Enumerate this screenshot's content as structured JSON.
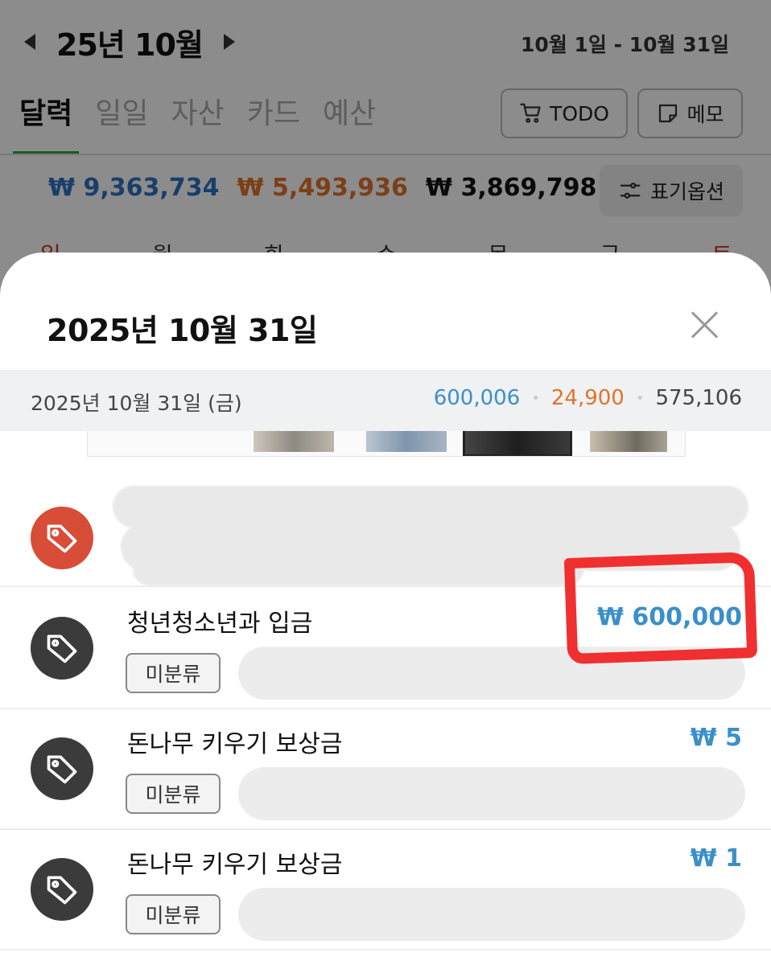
{
  "header": {
    "month_title": "25년 10월",
    "date_range": "10월 1일 - 10월 31일"
  },
  "tabs": [
    "달력",
    "일일",
    "자산",
    "카드",
    "예산"
  ],
  "actions": {
    "todo_label": "TODO",
    "memo_label": "메모",
    "display_options_label": "표기옵션"
  },
  "summary": {
    "income": "₩ 9,363,734",
    "expense": "₩ 5,493,936",
    "total": "₩ 3,869,798"
  },
  "weekdays": [
    "일",
    "월",
    "화",
    "수",
    "목",
    "금",
    "토"
  ],
  "colors": {
    "income": "#2f72c4",
    "expense": "#e0742b",
    "accent_green": "#2eaa3c",
    "annotation_red": "#f03030"
  },
  "sheet": {
    "title": "2025년 10월 31일",
    "day_label": "2025년 10월 31일 (금)",
    "day_income": "600,006",
    "day_expense": "24,900",
    "day_total": "575,106",
    "separator": "•",
    "transactions": [
      {
        "title": "청년청소년과 입금",
        "amount": "₩ 600,000",
        "category": "미분류",
        "icon": "tag-icon"
      },
      {
        "title": "돈나무 키우기 보상금",
        "amount": "₩ 5",
        "category": "미분류",
        "icon": "tag-icon"
      },
      {
        "title": "돈나무 키우기 보상금",
        "amount": "₩ 1",
        "category": "미분류",
        "icon": "tag-icon"
      }
    ]
  }
}
